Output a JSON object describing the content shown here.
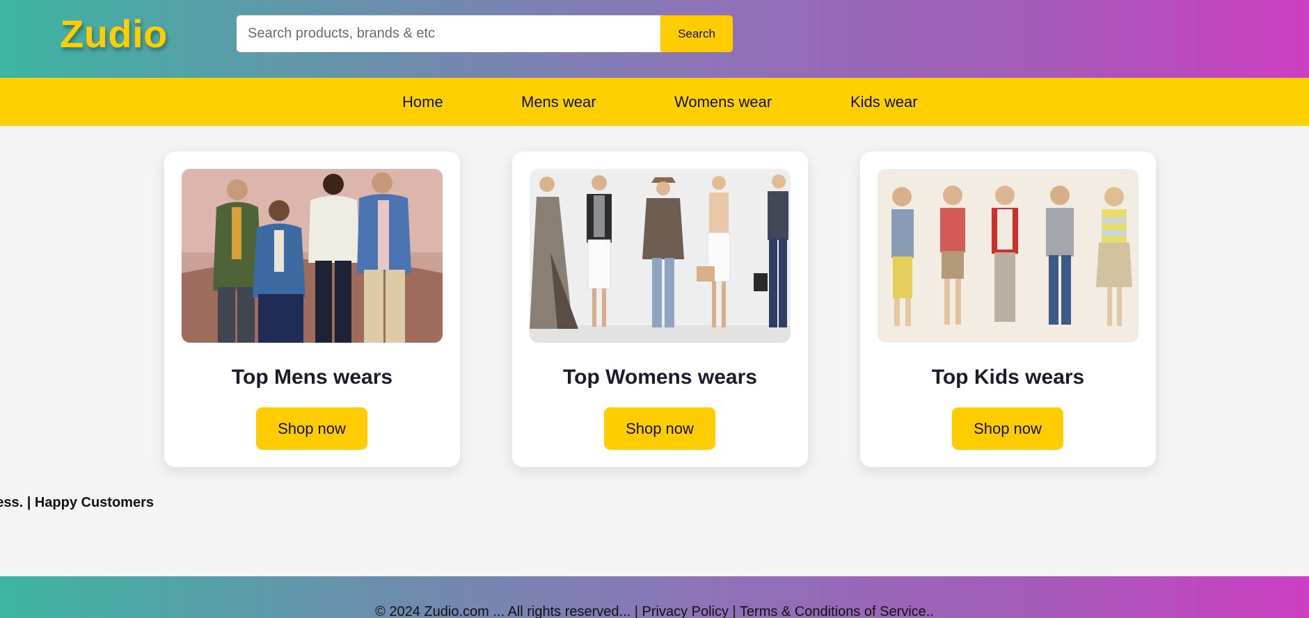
{
  "brand": {
    "logo": "Zudio",
    "accent": "#ffce00"
  },
  "search": {
    "placeholder": "Search products, brands & etc",
    "value": "",
    "button_label": "Search"
  },
  "nav": {
    "items": [
      {
        "label": "Home"
      },
      {
        "label": "Mens wear"
      },
      {
        "label": "Womens wear"
      },
      {
        "label": "Kids wear"
      }
    ]
  },
  "cards": [
    {
      "title": "Top Mens wears",
      "button_label": "Shop now",
      "image": "mens-models-photo"
    },
    {
      "title": "Top Womens wears",
      "button_label": "Shop now",
      "image": "womens-models-photo"
    },
    {
      "title": "Top Kids wears",
      "button_label": "Shop now",
      "image": "kids-models-photo"
    }
  ],
  "marquee": {
    "text": "ppiness. | Happy Customers"
  },
  "footer": {
    "text": "© 2024 Zudio.com ... All rights reserved... | Privacy Policy | Terms & Conditions of Service.."
  },
  "colors": {
    "gradient_start": "#3db5a2",
    "gradient_end": "#cc3fc2",
    "nav_bg": "#ffd000",
    "button_bg": "#ffcc00"
  }
}
